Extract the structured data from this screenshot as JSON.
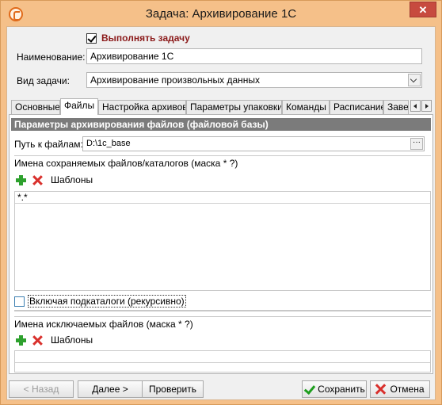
{
  "window": {
    "title": "Задача: Архивирование 1С",
    "close_glyph": "✕"
  },
  "task": {
    "enabled_label": "Выполнять задачу",
    "enabled": true,
    "name_label": "Наименование:",
    "name_value": "Архивирование 1С",
    "type_label": "Вид задачи:",
    "type_value": "Архивирование произвольных данных"
  },
  "tabs": [
    {
      "label": "Основные",
      "active": false
    },
    {
      "label": "Файлы",
      "active": true
    },
    {
      "label": "Настройка архивов",
      "active": false
    },
    {
      "label": "Параметры упаковки",
      "active": false
    },
    {
      "label": "Команды",
      "active": false
    },
    {
      "label": "Расписание",
      "active": false
    },
    {
      "label": "Заве",
      "active": false
    }
  ],
  "files_panel": {
    "header": "Параметры архивирования файлов (файловой базы)",
    "path_label": "Путь к файлам:",
    "path_value": "D:\\1c_base",
    "path_button": "···",
    "include_group_label": "Имена сохраняемых файлов/каталогов (маска * ?)",
    "templates_label": "Шаблоны",
    "include_items": [
      "*.*"
    ],
    "recursive_label": "Включая подкаталоги (рекурсивно)",
    "recursive_checked": false,
    "exclude_group_label": "Имена исключаемых файлов  (маска * ?)",
    "exclude_templates_label": "Шаблоны",
    "exclude_items": []
  },
  "footer": {
    "back_label": "< Назад",
    "next_label": "Далее >",
    "check_label": "Проверить",
    "save_label": "Сохранить",
    "cancel_label": "Отмена"
  },
  "icons": {
    "app": "app-logo-icon",
    "add": "plus-icon",
    "delete": "red-x-icon",
    "save": "green-check-icon",
    "cancel": "red-x-icon"
  },
  "colors": {
    "titlebar": "#f5c089",
    "close_button": "#c74a3f",
    "section_header": "#7b7b7b",
    "enabled_label": "#8b1a1a"
  }
}
